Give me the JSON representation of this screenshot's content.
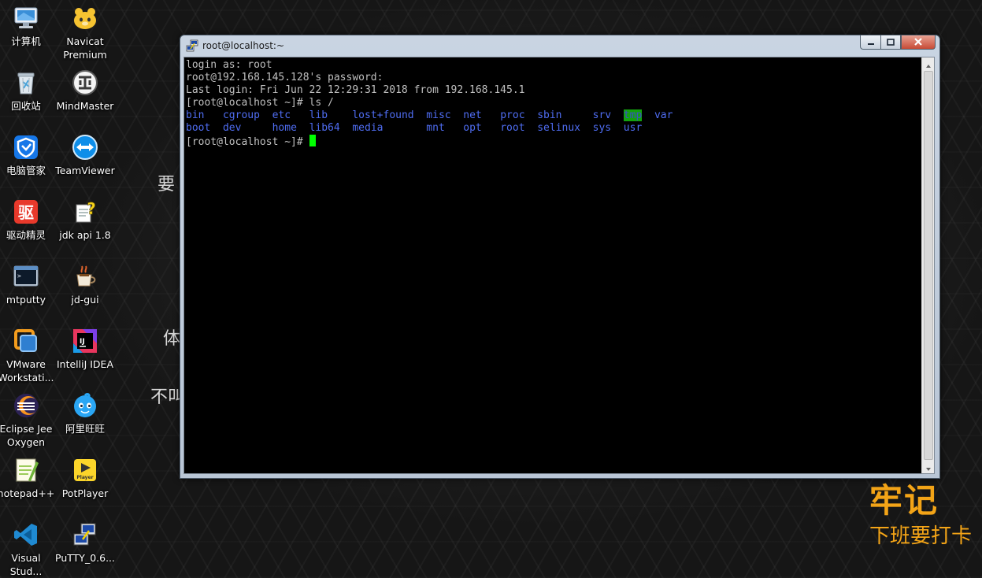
{
  "desktop": {
    "icons": [
      {
        "label": "计算机",
        "icon": "computer-icon"
      },
      {
        "label": "Navicat\nPremium",
        "icon": "navicat-icon"
      },
      {
        "label": "回收站",
        "icon": "recycle-bin-icon"
      },
      {
        "label": "MindMaster",
        "icon": "mindmaster-icon"
      },
      {
        "label": "电脑管家",
        "icon": "pc-manager-icon"
      },
      {
        "label": "TeamViewer",
        "icon": "teamviewer-icon"
      },
      {
        "label": "驱动精灵",
        "icon": "driver-genius-icon"
      },
      {
        "label": "jdk api 1.8",
        "icon": "help-doc-icon"
      },
      {
        "label": "mtputty",
        "icon": "mtputty-icon"
      },
      {
        "label": "jd-gui",
        "icon": "java-cup-icon"
      },
      {
        "label": "VMware\nWorkstati...",
        "icon": "vmware-icon"
      },
      {
        "label": "IntelliJ IDEA",
        "icon": "intellij-icon"
      },
      {
        "label": "Eclipse Jee\nOxygen",
        "icon": "eclipse-icon"
      },
      {
        "label": "阿里旺旺",
        "icon": "aliwangwang-icon"
      },
      {
        "label": "notepad++",
        "icon": "notepadpp-icon"
      },
      {
        "label": "PotPlayer",
        "icon": "potplayer-icon"
      },
      {
        "label": "Visual\nStud...",
        "icon": "vscode-icon"
      },
      {
        "label": "PuTTY_0.6...",
        "icon": "putty-icon"
      }
    ]
  },
  "wallpaper": {
    "fragments": [
      "要",
      "体",
      "不叫"
    ],
    "brand_title": "牢记",
    "brand_subtitle": "下班要打卡"
  },
  "window": {
    "title": "root@localhost:~",
    "icons": {
      "app": "putty-icon",
      "minimize": "minimize-icon",
      "maximize": "maximize-icon",
      "close": "close-icon"
    }
  },
  "terminal": {
    "lines": [
      "login as: root",
      "root@192.168.145.128's password:",
      "Last login: Fri Jun 22 12:29:31 2018 from 192.168.145.1",
      "[root@localhost ~]# ls /"
    ],
    "ls_rows": [
      [
        "bin",
        "cgroup",
        "etc",
        "lib",
        "lost+found",
        "misc",
        "net",
        "proc",
        "sbin",
        "srv",
        "tmp",
        "var"
      ],
      [
        "boot",
        "dev",
        "home",
        "lib64",
        "media",
        "mnt",
        "opt",
        "root",
        "selinux",
        "sys",
        "usr",
        ""
      ]
    ],
    "highlighted_entry": "tmp",
    "prompt": "[root@localhost ~]# ",
    "colors": {
      "foreground": "#c0c0c0",
      "directory": "#4f6df2",
      "highlight_bg": "#13a10e",
      "cursor": "#00ff00",
      "background": "#000000"
    }
  }
}
